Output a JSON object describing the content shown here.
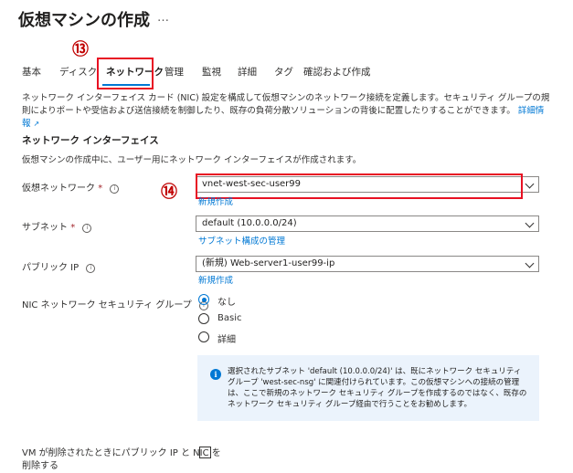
{
  "page": {
    "title": "仮想マシンの作成",
    "more": "…"
  },
  "annotations": {
    "a13": "⑬",
    "a14": "⑭"
  },
  "tabs": [
    {
      "label": "基本"
    },
    {
      "label": "ディスク"
    },
    {
      "label": "ネットワーク"
    },
    {
      "label": "管理"
    },
    {
      "label": "監視"
    },
    {
      "label": "詳細"
    },
    {
      "label": "タグ"
    },
    {
      "label": "確認および作成"
    }
  ],
  "active_tab": "ネットワーク",
  "description": {
    "text": "ネットワーク インターフェイス カード (NIC) 設定を構成して仮想マシンのネットワーク接続を定義します。セキュリティ グループの規則によりポートや受信および送信接続を制御したり、既存の負荷分散ソリューションの背後に配置したりすることができます。",
    "link": "詳細情報"
  },
  "section": {
    "title": "ネットワーク インターフェイス",
    "subtitle": "仮想マシンの作成中に、ユーザー用にネットワーク インターフェイスが作成されます。"
  },
  "fields": {
    "vnet": {
      "label": "仮想ネットワーク",
      "required": "*",
      "value": "vnet-west-sec-user99",
      "link": "新規作成"
    },
    "subnet": {
      "label": "サブネット",
      "required": "*",
      "value": "default (10.0.0.0/24)",
      "link": "サブネット構成の管理"
    },
    "public_ip": {
      "label": "パブリック IP",
      "value": "(新規) Web-server1-user99-ip",
      "link": "新規作成"
    },
    "nsg": {
      "label": "NIC ネットワーク セキュリティ グループ",
      "options": [
        "なし",
        "Basic",
        "詳細"
      ],
      "selected": "なし"
    },
    "delete_ip": {
      "label_line1": "VM が削除されたときにパブリック IP と NIC を",
      "label_line2": "削除する",
      "checked": false
    }
  },
  "info_message": "選択されたサブネット 'default (10.0.0.0/24)' は、既にネットワーク セキュリティ グループ 'west-sec-nsg' に関連付けられています。この仮想マシンへの接続の管理は、ここで新規のネットワーク セキュリティ グループを作成するのではなく、既存のネットワーク セキュリティ グループ経由で行うことをお勧めします。",
  "colors": {
    "accent": "#0078d4",
    "highlight": "#e81123",
    "annotation": "#c00000",
    "info_bg": "#ebf3fc"
  }
}
